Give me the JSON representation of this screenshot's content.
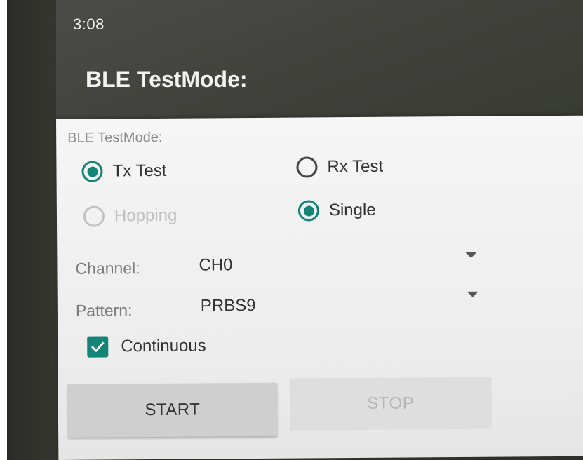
{
  "status_bar": {
    "time": "3:08"
  },
  "app_bar": {
    "title": "BLE TestMode:"
  },
  "dialog": {
    "section_label": "BLE TestMode:",
    "radios": {
      "tx_test": {
        "label": "Tx Test",
        "checked": true,
        "enabled": true
      },
      "rx_test": {
        "label": "Rx Test",
        "checked": false,
        "enabled": true
      },
      "hopping": {
        "label": "Hopping",
        "checked": false,
        "enabled": false
      },
      "single": {
        "label": "Single",
        "checked": true,
        "enabled": true
      }
    },
    "channel": {
      "label": "Channel:",
      "value": "CH0"
    },
    "pattern": {
      "label": "Pattern:",
      "value": "PRBS9"
    },
    "continuous": {
      "label": "Continuous",
      "checked": true
    },
    "buttons": {
      "start": {
        "label": "START",
        "enabled": true
      },
      "stop": {
        "label": "STOP",
        "enabled": false
      }
    }
  },
  "colors": {
    "accent": "#138577",
    "disabled": "#c2c2c2"
  },
  "icons": {
    "dropdown": "arrow-drop-down-icon",
    "check": "check-icon"
  }
}
